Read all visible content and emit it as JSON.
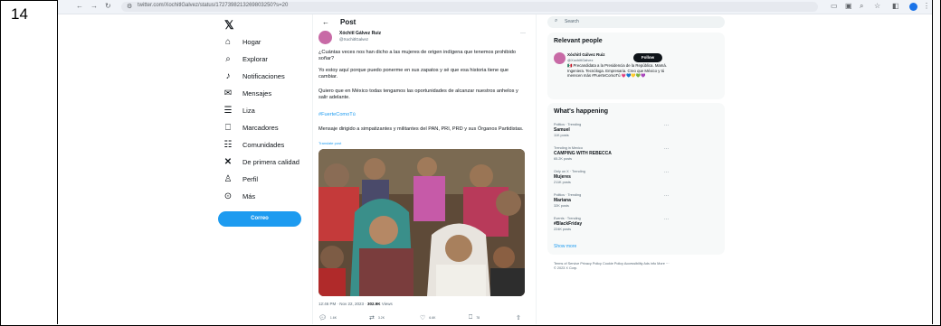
{
  "row_number": "14",
  "browser": {
    "url": "twitter.com/XochitlGalvez/status/1727398213269803250?s=20"
  },
  "nav": {
    "items": [
      {
        "label": "Hogar",
        "icon": "home-icon"
      },
      {
        "label": "Explorar",
        "icon": "search-icon"
      },
      {
        "label": "Notificaciones",
        "icon": "bell-icon"
      },
      {
        "label": "Mensajes",
        "icon": "mail-icon"
      },
      {
        "label": "Liza",
        "icon": "list-icon"
      },
      {
        "label": "Marcadores",
        "icon": "bookmark-icon"
      },
      {
        "label": "Comunidades",
        "icon": "communities-icon"
      },
      {
        "label": "De primera calidad",
        "icon": "x-premium-icon"
      },
      {
        "label": "Perfil",
        "icon": "profile-icon"
      },
      {
        "label": "Más",
        "icon": "more-icon"
      }
    ],
    "post_button": "Correo"
  },
  "post": {
    "header_title": "Post",
    "author_name": "Xóchitl Gálvez Ruiz",
    "author_handle": "@XochitlGalvez",
    "paragraphs": [
      "¿Cuántas veces nos han dicho a las mujeres de origen indígena que tenemos prohibido soñar?",
      "Yo estoy aquí porque puedo ponerme en sus zapatos y sé que esa historia tiene que cambiar.",
      "Quiero que en México todas tengamos las oportunidades de alcanzar nuestros anhelos y salir adelante."
    ],
    "hashtag": "#FuerteComoTú",
    "note": "Mensaje dirigido a simpatizantes y militantes del PAN, PRI, PRD y sus Órganos Partidistas.",
    "translate": "Translate post",
    "timestamp": "12:46 PM · Nov 22, 2023 ·",
    "views": "302.9K",
    "views_label": "Views",
    "counts": {
      "replies": "1.6K",
      "reposts": "3.2K",
      "likes": "6.6K",
      "bookmarks": "78"
    }
  },
  "sidebar": {
    "search_placeholder": "Search",
    "relevant_title": "Relevant people",
    "person": {
      "name": "Xóchitl Gálvez Ruiz",
      "handle": "@XochitlGalvez",
      "follow": "Follow",
      "bio": "🇲🇽 Precandidata a la Presidencia de la República. Mamá. Ingeniera. Tecnóloga. Empresaria. Creo que México y tú merecen más #FuerteComoTú 💗💙💛💚💜"
    },
    "happening_title": "What's happening",
    "trends": [
      {
        "context": "Politics · Trending",
        "name": "Samuel",
        "count": "11K posts"
      },
      {
        "context": "Trending in Mexico",
        "name": "CAMPING WITH REBECCA",
        "count": "65.2K posts"
      },
      {
        "context": "Only on X · Trending",
        "name": "Mujeres",
        "count": "211K posts"
      },
      {
        "context": "Politics · Trending",
        "name": "Mariana",
        "count": "32K posts"
      },
      {
        "context": "Events · Trending",
        "name": "#BlackFriday",
        "count": "224K posts"
      }
    ],
    "show_more": "Show more",
    "footer": "Terms of Service  Privacy Policy  Cookie Policy  Accessibility  Ads info  More ···  © 2023 X Corp."
  }
}
